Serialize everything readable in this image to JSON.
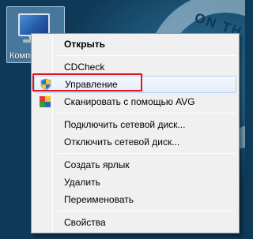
{
  "desktop": {
    "wallpaper_text": "ON TH",
    "icon_label": "Компьютер"
  },
  "context_menu": {
    "items": [
      {
        "label": "Открыть",
        "bold": true
      },
      {
        "label": "CDCheck"
      },
      {
        "label": "Управление",
        "icon": "uac-shield-icon",
        "highlighted": true
      },
      {
        "label": "Сканировать с помощью AVG",
        "icon": "avg-icon"
      },
      {
        "label": "Подключить сетевой диск..."
      },
      {
        "label": "Отключить сетевой диск..."
      },
      {
        "label": "Создать ярлык"
      },
      {
        "label": "Удалить"
      },
      {
        "label": "Переименовать"
      },
      {
        "label": "Свойства"
      }
    ]
  },
  "colors": {
    "highlight_outline": "#e0161b",
    "menu_background": "#f0f0f0",
    "hover_border": "#aecff7"
  }
}
